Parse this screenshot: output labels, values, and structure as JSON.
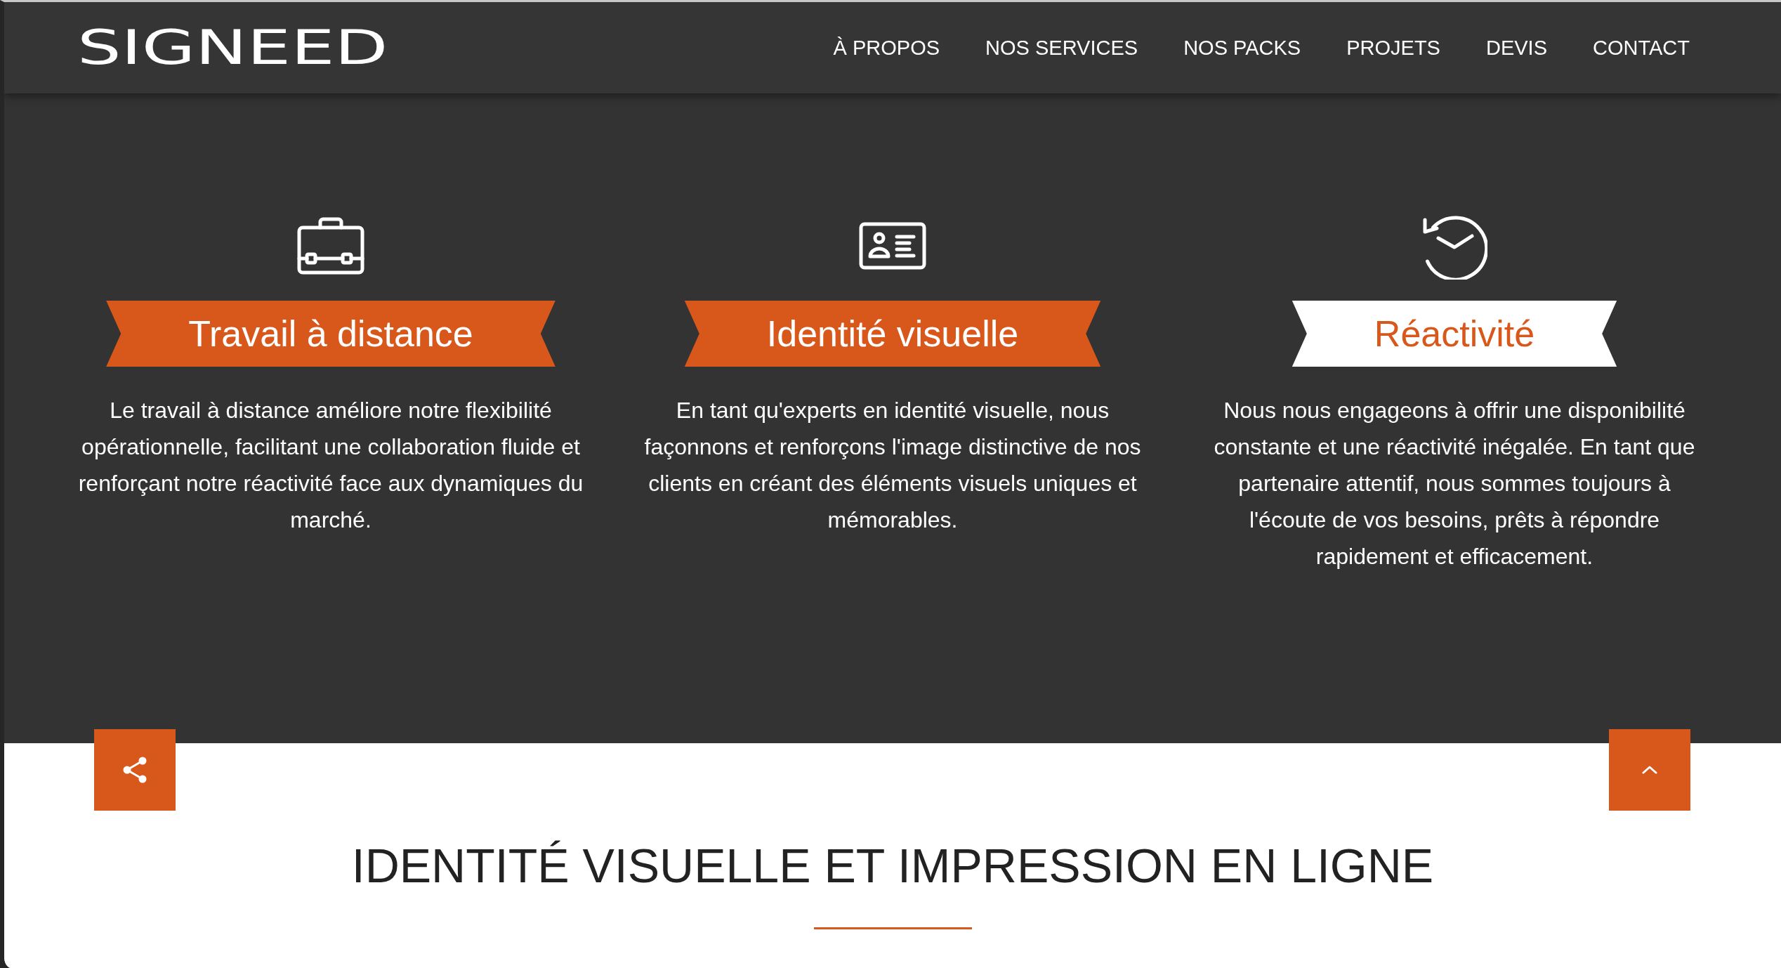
{
  "header": {
    "logo": "SIGNEED",
    "nav": [
      {
        "label": "À PROPOS"
      },
      {
        "label": "NOS SERVICES"
      },
      {
        "label": "NOS PACKS"
      },
      {
        "label": "PROJETS"
      },
      {
        "label": "DEVIS"
      },
      {
        "label": "CONTACT"
      }
    ]
  },
  "features": [
    {
      "title": "Travail à distance",
      "selected": false,
      "text": "Le travail à distance améliore notre flexibilité opérationnelle, facilitant une collaboration fluide et renforçant notre réactivité face aux dynamiques du marché."
    },
    {
      "title": "Identité visuelle",
      "selected": false,
      "text": "En tant qu'experts en identité visuelle, nous façonnons et renforçons l'image distinctive de nos clients en créant des éléments visuels uniques et mémorables."
    },
    {
      "title": "Réactivité",
      "selected": true,
      "text": "Nous nous engageons à offrir une disponibilité constante et une réactivité inégalée. En tant que partenaire attentif, nous sommes toujours à l'écoute de vos besoins, prêts à répondre rapidement et efficacement."
    }
  ],
  "section": {
    "heading": "IDENTITÉ VISUELLE ET IMPRESSION EN LIGNE"
  }
}
